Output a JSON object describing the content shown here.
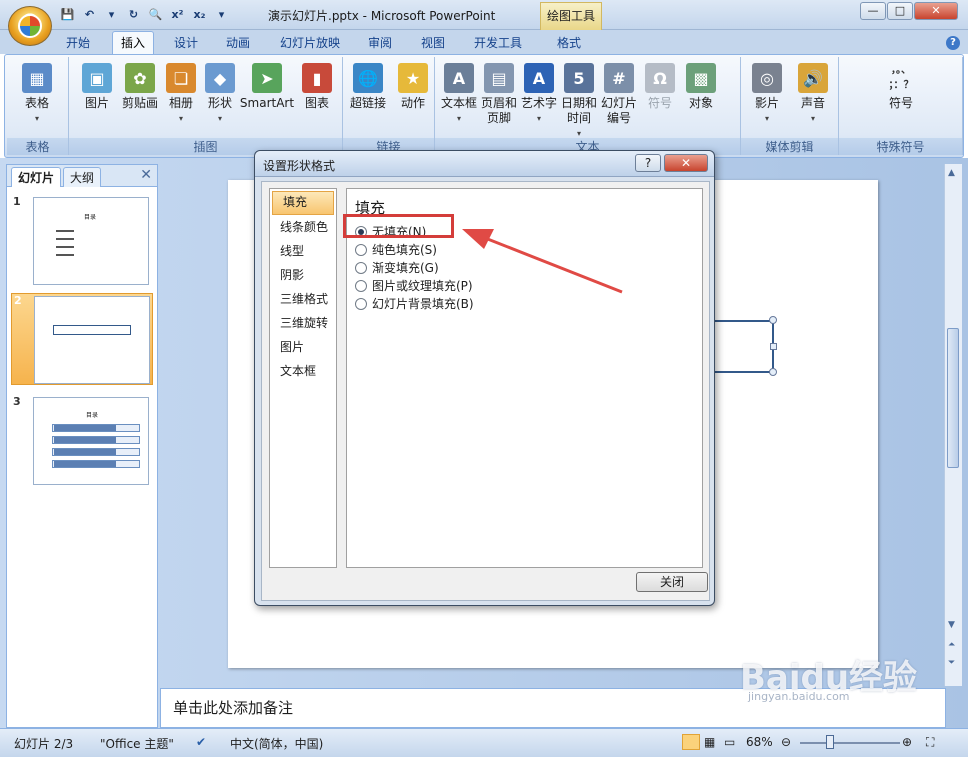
{
  "window": {
    "title": "演示幻灯片.pptx - Microsoft PowerPoint",
    "context_tab": "绘图工具",
    "controls": [
      "—",
      "□",
      "✕"
    ]
  },
  "qat": [
    "💾",
    "↶",
    "▾",
    "↻",
    "🔍",
    "x²",
    "x₂",
    "▾"
  ],
  "tabs": [
    "开始",
    "插入",
    "设计",
    "动画",
    "幻灯片放映",
    "审阅",
    "视图",
    "开发工具",
    "格式"
  ],
  "active_tab": "插入",
  "ribbon": {
    "groups": [
      {
        "label": "表格",
        "buttons": [
          {
            "label": "表格",
            "icon": "table-icon",
            "color": "#5b8bc8",
            "glyph": "▦"
          }
        ]
      },
      {
        "label": "插图",
        "buttons": [
          {
            "label": "图片",
            "icon": "picture-icon",
            "color": "#5ea6d6",
            "glyph": "▣"
          },
          {
            "label": "剪贴画",
            "icon": "clipart-icon",
            "color": "#7ba64a",
            "glyph": "✿"
          },
          {
            "label": "相册",
            "icon": "album-icon",
            "color": "#d9892e",
            "glyph": "❏"
          },
          {
            "label": "形状",
            "icon": "shapes-icon",
            "color": "#6b9ad0",
            "glyph": "◆"
          },
          {
            "label": "SmartArt",
            "icon": "smartart-icon",
            "color": "#58a45c",
            "glyph": "➤"
          },
          {
            "label": "图表",
            "icon": "chart-icon",
            "color": "#c84a3a",
            "glyph": "▮"
          }
        ]
      },
      {
        "label": "链接",
        "buttons": [
          {
            "label": "超链接",
            "icon": "hyperlink-icon",
            "color": "#3a86c6",
            "glyph": "🌐"
          },
          {
            "label": "动作",
            "icon": "action-icon",
            "color": "#e6b93a",
            "glyph": "★"
          }
        ]
      },
      {
        "label": "文本",
        "buttons": [
          {
            "label": "文本框",
            "icon": "textbox-icon",
            "color": "#6b7f99",
            "glyph": "A"
          },
          {
            "label": "页眉和\n页脚",
            "icon": "header-footer-icon",
            "color": "#8396b0",
            "glyph": "▤"
          },
          {
            "label": "艺术字",
            "icon": "wordart-icon",
            "color": "#2d63b5",
            "glyph": "A"
          },
          {
            "label": "日期和\n时间",
            "icon": "datetime-icon",
            "color": "#59739a",
            "glyph": "5"
          },
          {
            "label": "幻灯片\n编号",
            "icon": "slide-number-icon",
            "color": "#7c8fa9",
            "glyph": "#"
          },
          {
            "label": "符号",
            "icon": "symbol-icon",
            "color": "#b5bcc6",
            "glyph": "Ω",
            "disabled": true
          },
          {
            "label": "对象",
            "icon": "object-icon",
            "color": "#6ca07a",
            "glyph": "▩"
          }
        ]
      },
      {
        "label": "媒体剪辑",
        "buttons": [
          {
            "label": "影片",
            "icon": "movie-icon",
            "color": "#7a8290",
            "glyph": "◎"
          },
          {
            "label": "声音",
            "icon": "sound-icon",
            "color": "#d9a53a",
            "glyph": "🔊"
          }
        ]
      },
      {
        "label": "特殊符号",
        "buttons": [
          {
            "label": "符号",
            "icon": "special-symbol-icon",
            "color": "#8a8a8a",
            "glyph": "，。、\n；：？"
          }
        ]
      }
    ]
  },
  "left_pane": {
    "tabs": [
      "幻灯片",
      "大纲"
    ],
    "slides": [
      {
        "number": "1",
        "title": "目录"
      },
      {
        "number": "2",
        "title": ""
      },
      {
        "number": "3",
        "title": "目录"
      }
    ]
  },
  "dialog": {
    "title": "设置形状格式",
    "help": "?",
    "close": "✕",
    "categories": [
      "填充",
      "线条颜色",
      "线型",
      "阴影",
      "三维格式",
      "三维旋转",
      "图片",
      "文本框"
    ],
    "selected_category": "填充",
    "panel_title": "填充",
    "options": [
      "无填充(N)",
      "纯色填充(S)",
      "渐变填充(G)",
      "图片或纹理填充(P)",
      "幻灯片背景填充(B)"
    ],
    "selected_option": "无填充(N)",
    "close_button": "关闭"
  },
  "notes_placeholder": "单击此处添加备注",
  "status": {
    "slide": "幻灯片 2/3",
    "theme": "\"Office 主题\"",
    "language": "中文(简体，中国)",
    "zoom": "68%"
  },
  "watermark": {
    "main": "Baidu经验",
    "sub": "jingyan.baidu.com"
  },
  "colors": {
    "highlight": "#d43d3a",
    "arrow": "#e04a45",
    "ribbon_border": "#8db2e3"
  }
}
